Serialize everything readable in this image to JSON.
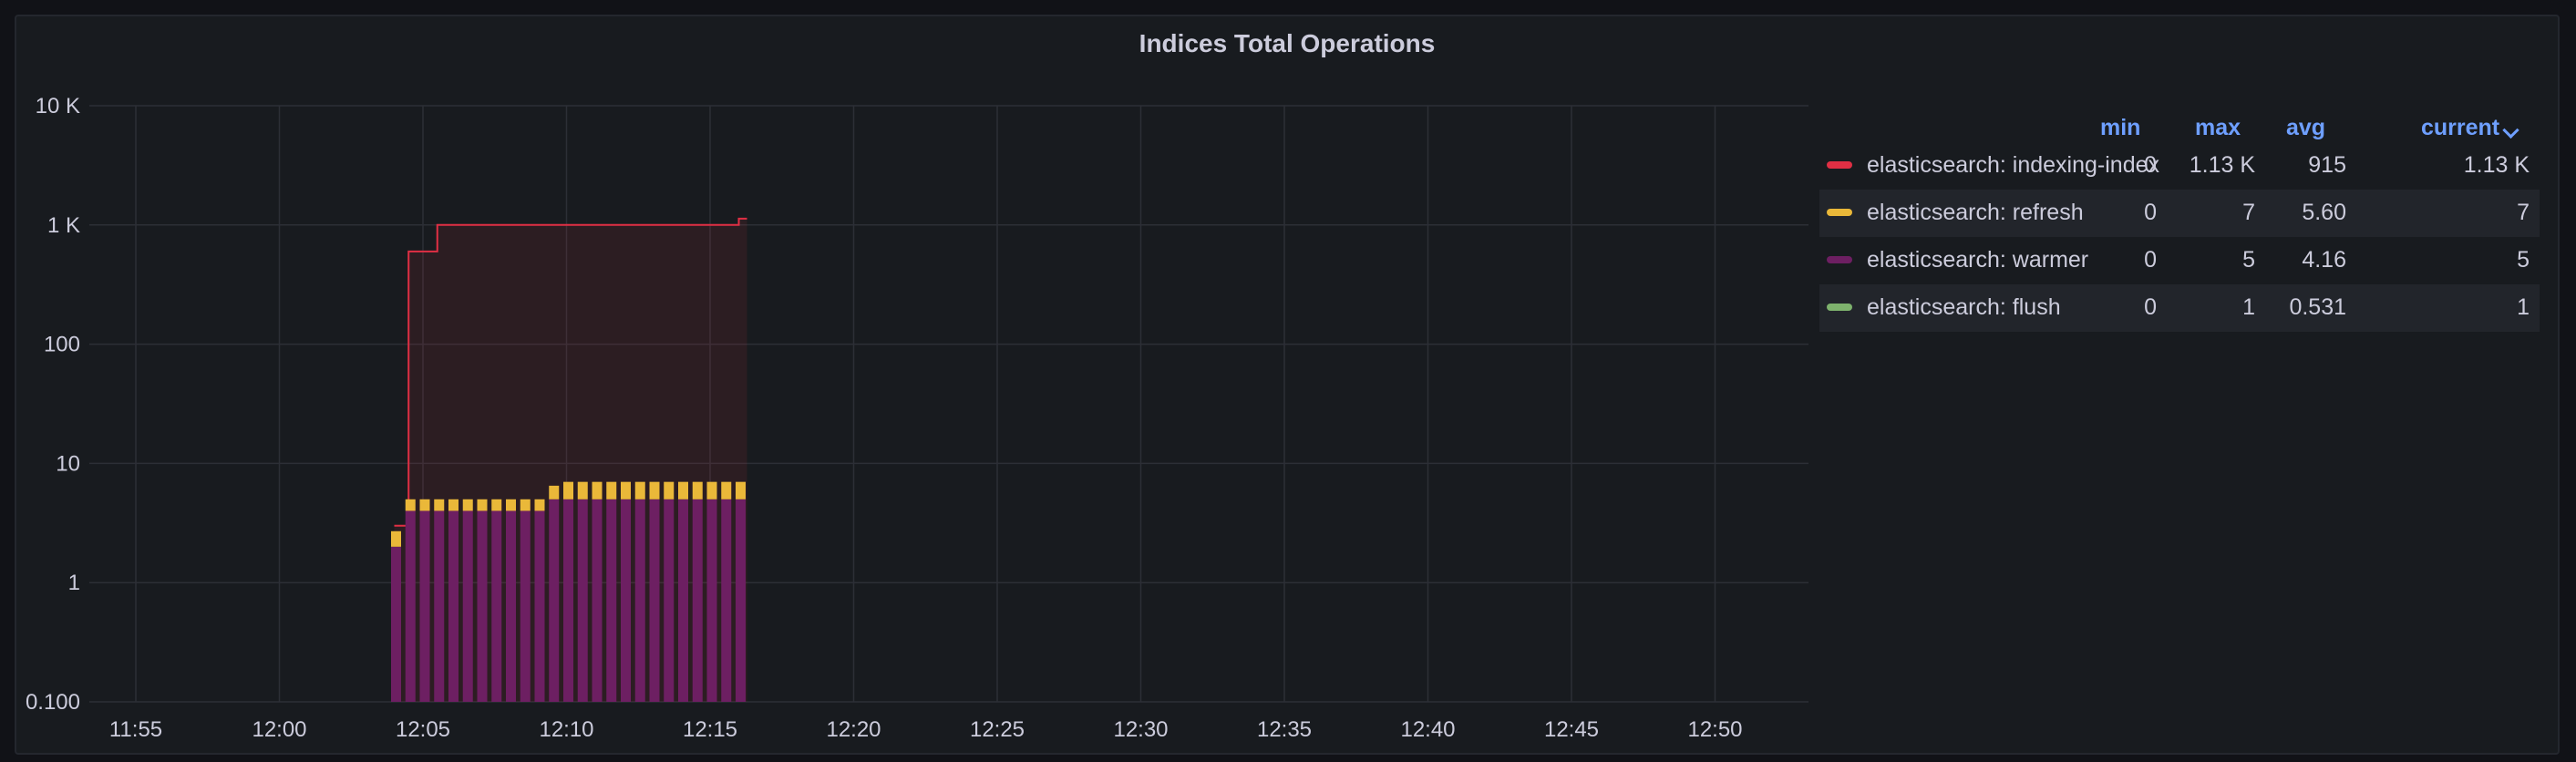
{
  "panel": {
    "title": "Indices Total Operations"
  },
  "legend": {
    "headers": {
      "min": "min",
      "max": "max",
      "avg": "avg",
      "current": "current"
    },
    "sort_icon": "chevron-down-icon",
    "rows": [
      {
        "name": "elasticsearch: indexing-index",
        "color": "#e02f44",
        "min": "0",
        "max": "1.13 K",
        "avg": "915",
        "current": "1.13 K"
      },
      {
        "name": "elasticsearch: refresh",
        "color": "#eab839",
        "min": "0",
        "max": "7",
        "avg": "5.60",
        "current": "7"
      },
      {
        "name": "elasticsearch: warmer",
        "color": "#6d1f62",
        "min": "0",
        "max": "5",
        "avg": "4.16",
        "current": "5"
      },
      {
        "name": "elasticsearch: flush",
        "color": "#7eb26d",
        "min": "0",
        "max": "1",
        "avg": "0.531",
        "current": "1"
      }
    ]
  },
  "chart_data": {
    "type": "bar",
    "scale": "log",
    "y_ticks": [
      "0.100",
      "1",
      "10",
      "100",
      "1 K",
      "10 K"
    ],
    "ylim": [
      0.1,
      10000
    ],
    "x_ticks": [
      "11:55",
      "12:00",
      "12:05",
      "12:10",
      "12:15",
      "12:20",
      "12:25",
      "12:30",
      "12:35",
      "12:40",
      "12:45",
      "12:50"
    ],
    "grid": true,
    "legend_placement": "right",
    "bar_x_start_minute": "12:04",
    "bar_spacing_seconds": 30,
    "series": [
      {
        "name": "elasticsearch: warmer",
        "color": "#6d1f62",
        "style": "stacked-bars",
        "values": [
          2,
          4,
          4,
          4,
          4,
          4,
          4,
          4,
          4,
          4,
          4,
          5,
          5,
          5,
          5,
          5,
          5,
          5,
          5,
          5,
          5,
          5,
          5,
          5,
          5
        ]
      },
      {
        "name": "elasticsearch: refresh",
        "color": "#eab839",
        "style": "stacked-bars",
        "values": [
          0.7,
          1,
          1,
          1,
          1,
          1,
          1,
          1,
          1,
          1,
          1,
          1.5,
          2,
          2,
          2,
          2,
          2,
          2,
          2,
          2,
          2,
          2,
          2,
          2,
          2
        ]
      },
      {
        "name": "elasticsearch: indexing-index",
        "color": "#e02f44",
        "style": "line-fill",
        "values": [
          3,
          600,
          600,
          1000,
          1000,
          1000,
          1000,
          1000,
          1000,
          1000,
          1000,
          1000,
          1000,
          1000,
          1000,
          1000,
          1000,
          1000,
          1000,
          1000,
          1000,
          1000,
          1000,
          1000,
          1130
        ]
      },
      {
        "name": "elasticsearch: flush",
        "color": "#7eb26d",
        "style": "stacked-bars",
        "values": []
      }
    ]
  }
}
